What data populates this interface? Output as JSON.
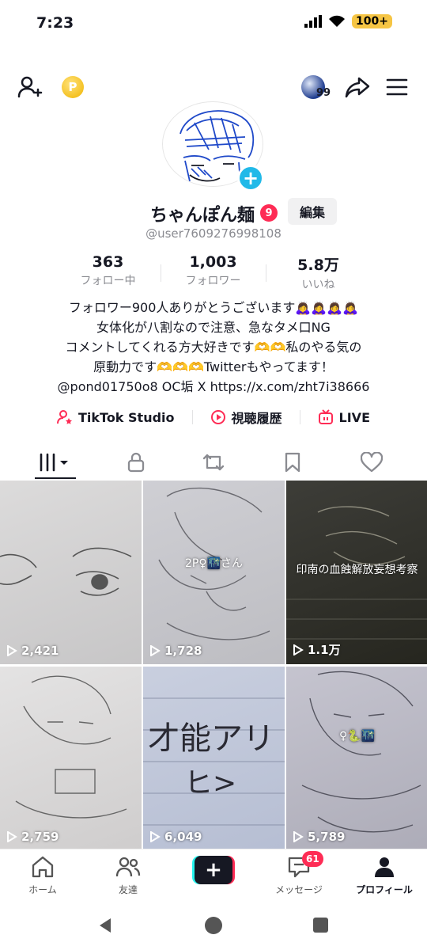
{
  "status": {
    "time": "7:23",
    "battery": "100+"
  },
  "topbar": {
    "globe_count": "99"
  },
  "profile": {
    "display_name": "ちゃんぽん麺",
    "name_badge": "9",
    "edit_label": "編集",
    "username": "@user7609276998108",
    "stats": [
      {
        "value": "363",
        "label": "フォロー中"
      },
      {
        "value": "1,003",
        "label": "フォロワー"
      },
      {
        "value": "5.8万",
        "label": "いいね"
      }
    ],
    "bio_lines": [
      "フォロワー900人ありがとうございます🙇‍♀️🙇‍♀️🙇‍♀️🙇‍♀️",
      "女体化が八割なので注意、急なタメ口NG",
      "コメントしてくれる方大好きです🫶🫶私のやる気の",
      "原動力です🫶🫶🫶Twitterもやってます！",
      "@pond01750o8 OC垢  X https://x.com/zht7i38666"
    ],
    "links": [
      {
        "label": "TikTok Studio",
        "icon": "person-star-icon"
      },
      {
        "label": "視聴履歴",
        "icon": "play-circle-icon"
      },
      {
        "label": "LIVE",
        "icon": "tv-icon"
      }
    ]
  },
  "tabs": [
    "videos",
    "private",
    "reposts",
    "favorites",
    "liked"
  ],
  "videos": [
    {
      "views": "2,421",
      "caption": ""
    },
    {
      "views": "1,728",
      "caption": "2P♀🌃さん"
    },
    {
      "views": "1.1万",
      "caption": "印南の血蝕解放妄想考察"
    },
    {
      "views": "2,759",
      "caption": ""
    },
    {
      "views": "6,049",
      "caption": ""
    },
    {
      "views": "5,789",
      "caption": "♀🐍🌃"
    }
  ],
  "drawing_text": {
    "line1": "才能アリ",
    "line2": "ヒ>"
  },
  "bottom_nav": {
    "home": "ホーム",
    "friends": "友達",
    "messages": "メッセージ",
    "messages_badge": "61",
    "profile": "プロフィール"
  },
  "colors": {
    "accent": "#fe2c55",
    "cyan": "#25f4ee",
    "text": "#161823",
    "muted": "#8a8b91"
  }
}
